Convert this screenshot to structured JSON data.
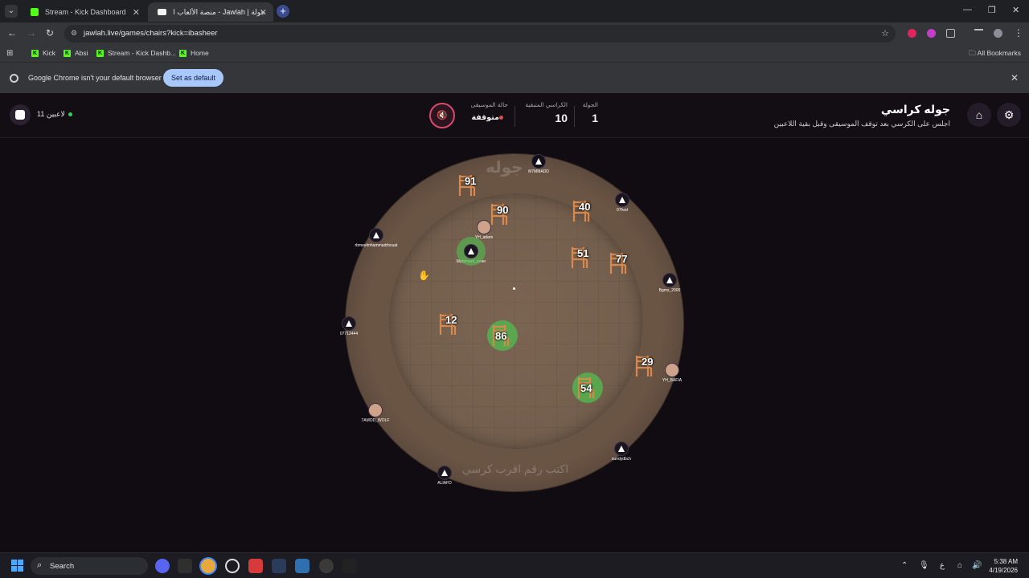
{
  "browser": {
    "tabs": [
      {
        "title": "Stream - Kick Dashboard",
        "active": false
      },
      {
        "title": "جولة | Jawlah - منصة الألعاب الت...",
        "active": true
      }
    ],
    "url": "jawlah.live/games/chairs?kick=ibasheer",
    "bookmarks": [
      "Kick",
      "Absi",
      "Stream - Kick Dashb...",
      "Home"
    ],
    "all_bookmarks": "All Bookmarks",
    "infobar": {
      "message": "Google Chrome isn't your default browser",
      "button": "Set as default"
    }
  },
  "game": {
    "players_online": "11 لاعبين",
    "music_label": "حالة الموسيقى",
    "music_status": "متوقفة",
    "chairs_label": "الكراسي المتبقية",
    "chairs_value": "10",
    "round_label": "الجولة",
    "round_value": "1",
    "title": "جوله كراسي",
    "subtitle": "اجلس على الكرسي بعد توقف الموسيقى وقبل بقية اللاعبين",
    "watermark": "جوله",
    "hint": "اكتب رقم اقرب كرسي",
    "chairs": [
      {
        "number": "91",
        "taken": false
      },
      {
        "number": "90",
        "taken": false
      },
      {
        "number": "40",
        "taken": false
      },
      {
        "number": "51",
        "taken": false
      },
      {
        "number": "77",
        "taken": false
      },
      {
        "number": "12",
        "taken": false
      },
      {
        "number": "86",
        "taken": true
      },
      {
        "number": "29",
        "taken": false
      },
      {
        "number": "54",
        "taken": true
      }
    ],
    "players": [
      {
        "name": "M7MMADD",
        "icon": "m-logo-icon"
      },
      {
        "name": "07hod",
        "icon": "ghost-avatar-icon"
      },
      {
        "name": "rbmeelmhammadrbouat",
        "icon": "ghost-avatar-icon"
      },
      {
        "name": "YH_adam",
        "icon": "photo-avatar"
      },
      {
        "name": "Mahmoud_amer",
        "icon": "ghost-avatar-icon"
      },
      {
        "name": "Bgms_2000",
        "icon": "ghost-avatar-icon"
      },
      {
        "name": "07712444",
        "icon": "ghost-avatar-icon"
      },
      {
        "name": "YH_BAFIA",
        "icon": "photo-avatar"
      },
      {
        "name": "7AMOD_WOLF",
        "icon": "photo-avatar"
      },
      {
        "name": "sundydbch",
        "icon": "ghost-avatar-icon"
      },
      {
        "name": "ALIAFD",
        "icon": "ghost-avatar-icon"
      }
    ]
  },
  "taskbar": {
    "search": "Search",
    "time": "5:38 AM",
    "date": "4/19/2026",
    "lang": "ع"
  }
}
